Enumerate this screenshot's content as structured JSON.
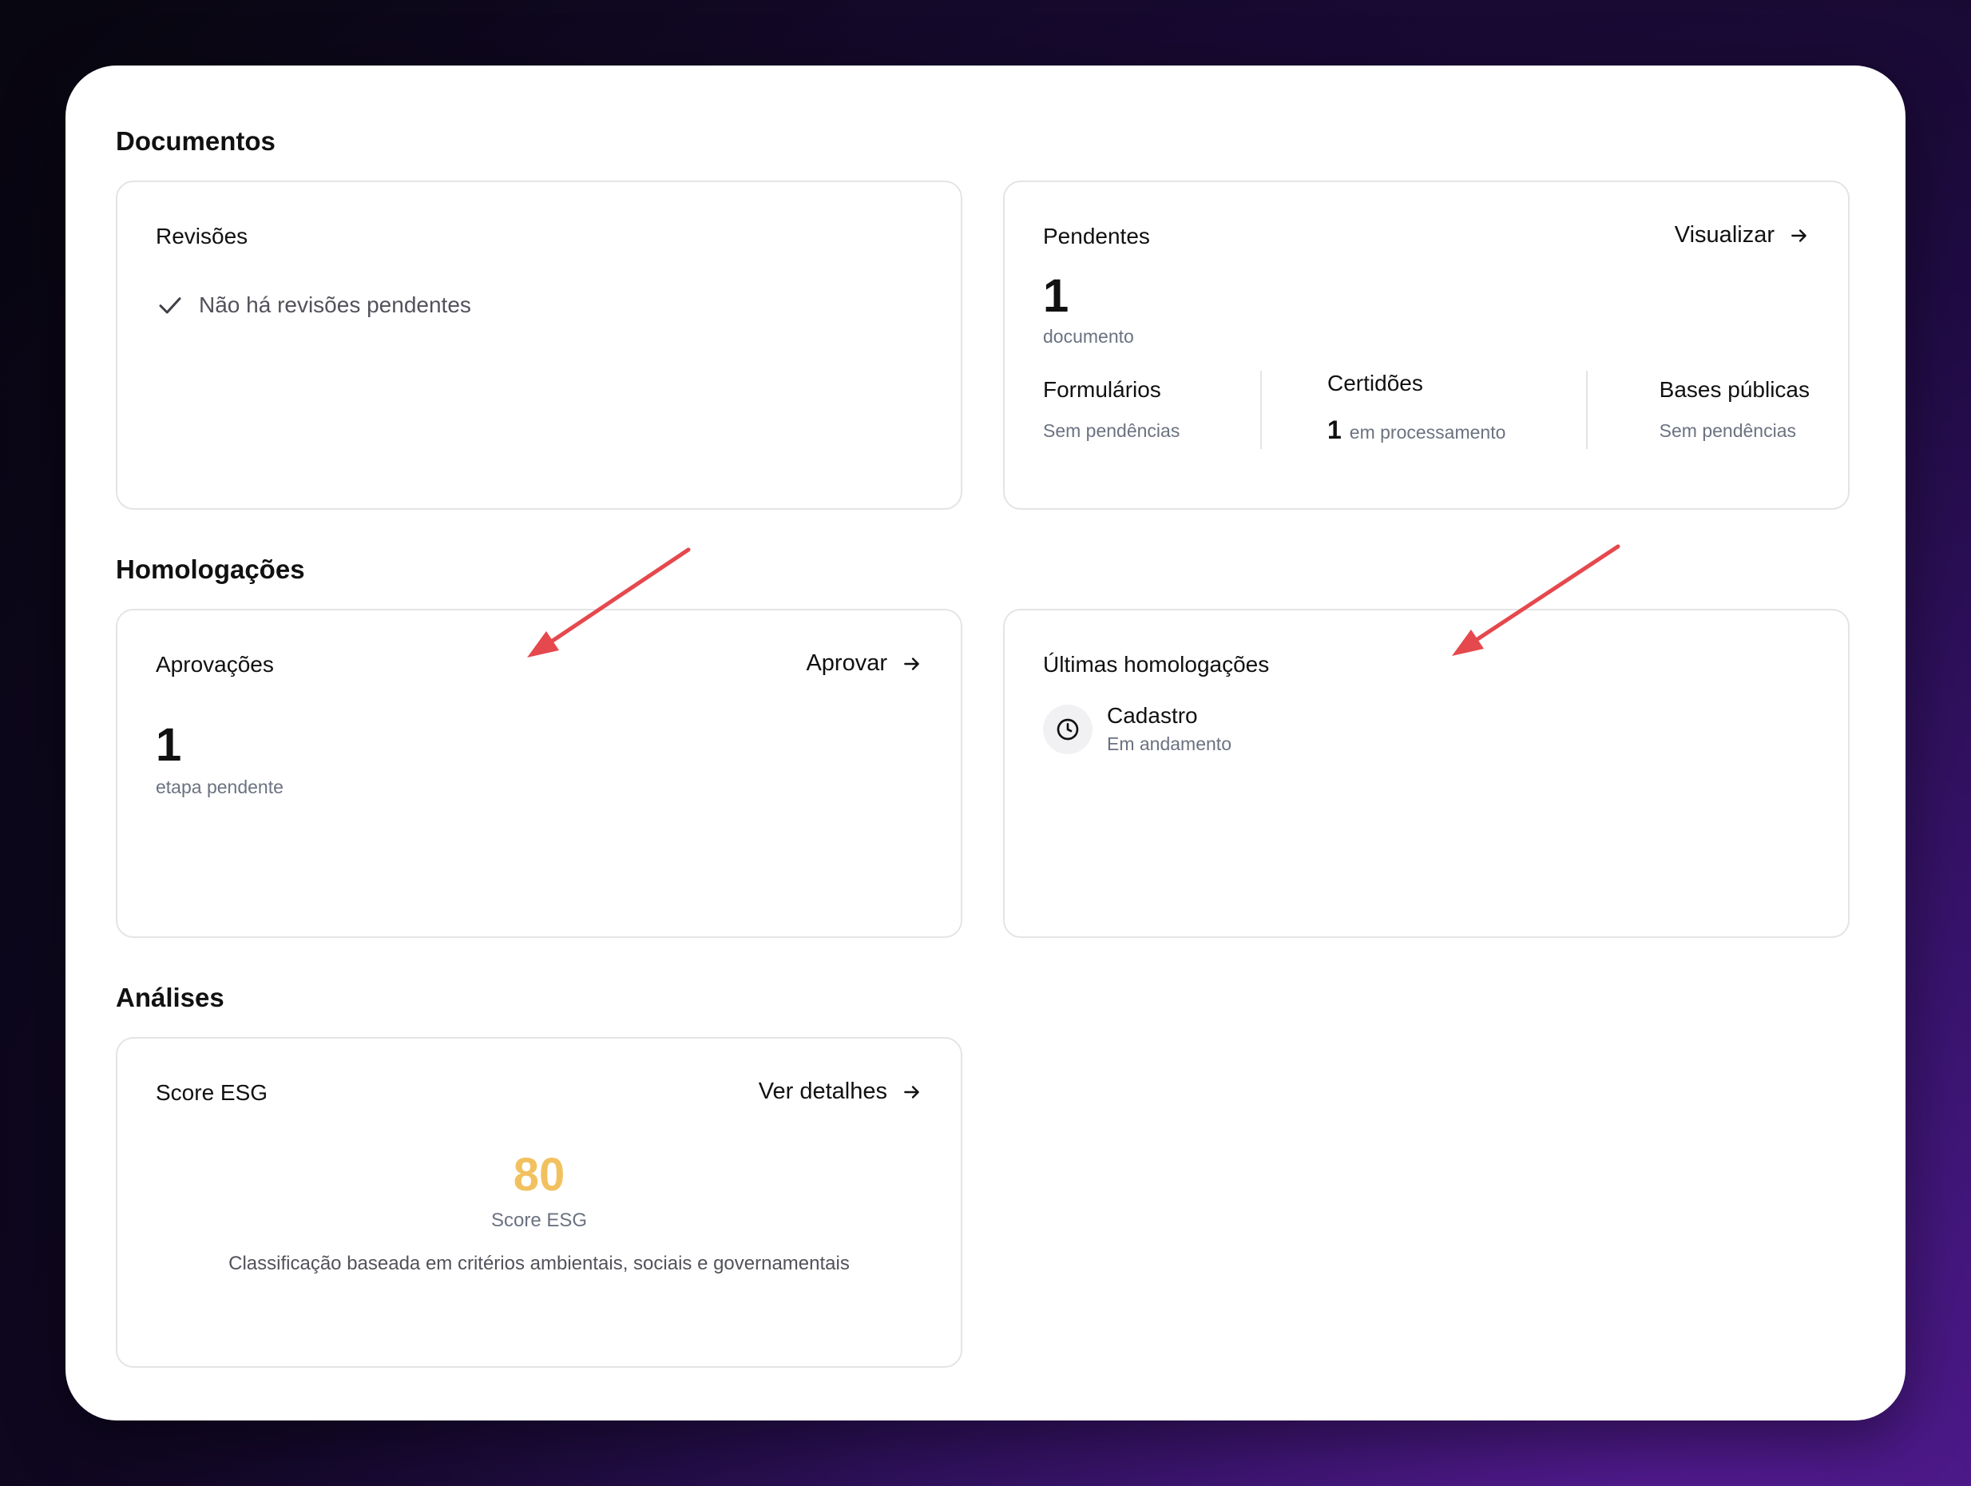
{
  "sections": {
    "documentos": "Documentos",
    "homologacoes": "Homologações",
    "analises": "Análises"
  },
  "revisoes": {
    "title": "Revisões",
    "empty_text": "Não há revisões pendentes",
    "icon": "check-icon"
  },
  "pendentes": {
    "title": "Pendentes",
    "action_label": "Visualizar",
    "count": "1",
    "unit": "documento",
    "columns": [
      {
        "title": "Formulários",
        "status": "Sem pendências"
      },
      {
        "title": "Certidões",
        "count": "1",
        "status": "em processamento"
      },
      {
        "title": "Bases públicas",
        "status": "Sem pendências"
      }
    ]
  },
  "aprovacoes": {
    "title": "Aprovações",
    "action_label": "Aprovar",
    "count": "1",
    "unit": "etapa pendente"
  },
  "ultimas": {
    "title": "Últimas homologações",
    "items": [
      {
        "name": "Cadastro",
        "status": "Em andamento",
        "icon": "clock-icon"
      }
    ]
  },
  "score": {
    "title": "Score ESG",
    "action_label": "Ver detalhes",
    "value": "80",
    "label": "Score ESG",
    "description": "Classificação baseada em critérios ambientais, sociais e governamentais",
    "value_color": "#f2c15f"
  },
  "colors": {
    "annotation_arrow": "#e5484d",
    "card_border": "#e4e4e7",
    "muted_text": "#6b7280"
  }
}
